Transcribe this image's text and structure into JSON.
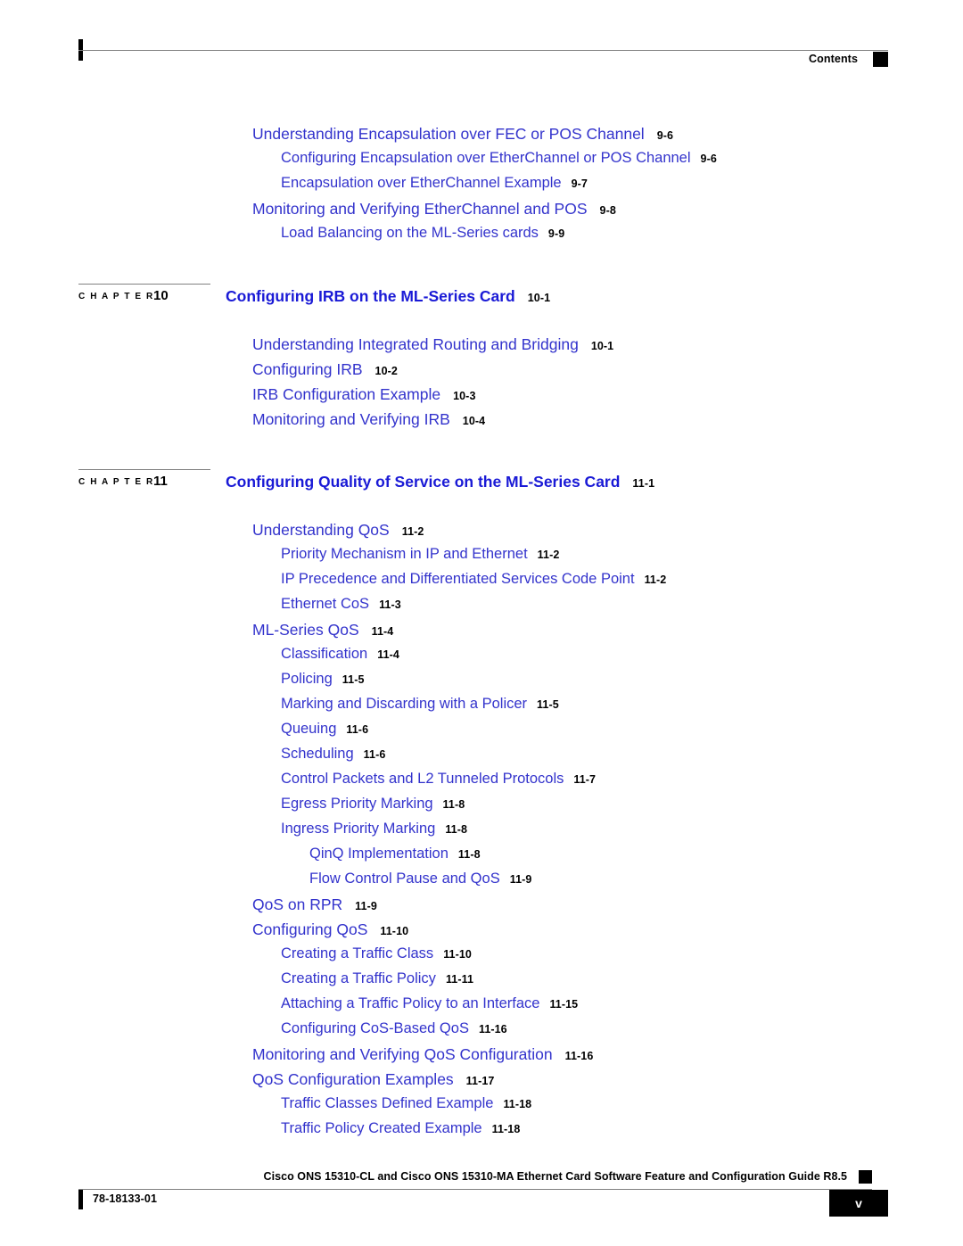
{
  "header": {
    "label": "Contents"
  },
  "toc": {
    "groups": [
      {
        "id": "group-chapter9-tail",
        "chapter": null,
        "entries": [
          {
            "level": 0,
            "title": "Understanding Encapsulation over FEC or POS Channel",
            "page": "9-6"
          },
          {
            "level": 1,
            "title": "Configuring Encapsulation over EtherChannel or POS Channel",
            "page": "9-6"
          },
          {
            "level": 1,
            "title": "Encapsulation over EtherChannel Example",
            "page": "9-7"
          },
          {
            "level": 0,
            "title": "Monitoring and Verifying EtherChannel and POS",
            "page": "9-8"
          },
          {
            "level": 1,
            "title": "Load Balancing on the ML-Series cards",
            "page": "9-9"
          }
        ]
      },
      {
        "id": "group-chapter10",
        "chapter": {
          "tag": "C H A P T E R",
          "number": "10",
          "title": "Configuring IRB on the ML-Series Card",
          "page": "10-1"
        },
        "entries": [
          {
            "level": 0,
            "title": "Understanding Integrated Routing and Bridging",
            "page": "10-1"
          },
          {
            "level": 0,
            "title": "Configuring IRB",
            "page": "10-2"
          },
          {
            "level": 0,
            "title": "IRB Configuration Example",
            "page": "10-3"
          },
          {
            "level": 0,
            "title": "Monitoring and Verifying IRB",
            "page": "10-4"
          }
        ]
      },
      {
        "id": "group-chapter11",
        "chapter": {
          "tag": "C H A P T E R",
          "number": "11",
          "title": "Configuring Quality of Service on the ML-Series Card",
          "page": "11-1"
        },
        "entries": [
          {
            "level": 0,
            "title": "Understanding QoS",
            "page": "11-2"
          },
          {
            "level": 1,
            "title": "Priority Mechanism in IP and Ethernet",
            "page": "11-2"
          },
          {
            "level": 1,
            "title": "IP Precedence and Differentiated Services Code Point",
            "page": "11-2"
          },
          {
            "level": 1,
            "title": "Ethernet CoS",
            "page": "11-3"
          },
          {
            "level": 0,
            "title": "ML-Series QoS",
            "page": "11-4"
          },
          {
            "level": 1,
            "title": "Classification",
            "page": "11-4"
          },
          {
            "level": 1,
            "title": "Policing",
            "page": "11-5"
          },
          {
            "level": 1,
            "title": "Marking and Discarding with a Policer",
            "page": "11-5"
          },
          {
            "level": 1,
            "title": "Queuing",
            "page": "11-6"
          },
          {
            "level": 1,
            "title": "Scheduling",
            "page": "11-6"
          },
          {
            "level": 1,
            "title": "Control Packets and L2 Tunneled Protocols",
            "page": "11-7"
          },
          {
            "level": 1,
            "title": "Egress Priority Marking",
            "page": "11-8"
          },
          {
            "level": 1,
            "title": "Ingress Priority Marking",
            "page": "11-8"
          },
          {
            "level": 2,
            "title": "QinQ Implementation",
            "page": "11-8"
          },
          {
            "level": 2,
            "title": "Flow Control Pause and QoS",
            "page": "11-9"
          },
          {
            "level": 0,
            "title": "QoS on RPR",
            "page": "11-9"
          },
          {
            "level": 0,
            "title": "Configuring QoS",
            "page": "11-10"
          },
          {
            "level": 1,
            "title": "Creating a Traffic Class",
            "page": "11-10"
          },
          {
            "level": 1,
            "title": "Creating a Traffic Policy",
            "page": "11-11"
          },
          {
            "level": 1,
            "title": "Attaching a Traffic Policy to an Interface",
            "page": "11-15"
          },
          {
            "level": 1,
            "title": "Configuring CoS-Based QoS",
            "page": "11-16"
          },
          {
            "level": 0,
            "title": "Monitoring and Verifying QoS Configuration",
            "page": "11-16"
          },
          {
            "level": 0,
            "title": "QoS Configuration Examples",
            "page": "11-17"
          },
          {
            "level": 1,
            "title": "Traffic Classes Defined Example",
            "page": "11-18"
          },
          {
            "level": 1,
            "title": "Traffic Policy Created Example",
            "page": "11-18"
          }
        ]
      }
    ]
  },
  "footer": {
    "title": "Cisco ONS 15310-CL and Cisco ONS 15310-MA Ethernet Card Software Feature and Configuration Guide R8.5",
    "doc_id": "78-18133-01",
    "page_number": "v"
  },
  "colors": {
    "link_blue": "#3333cc",
    "chapter_blue": "#1a1ad6",
    "rule_gray": "#808080",
    "ink_black": "#000000"
  }
}
